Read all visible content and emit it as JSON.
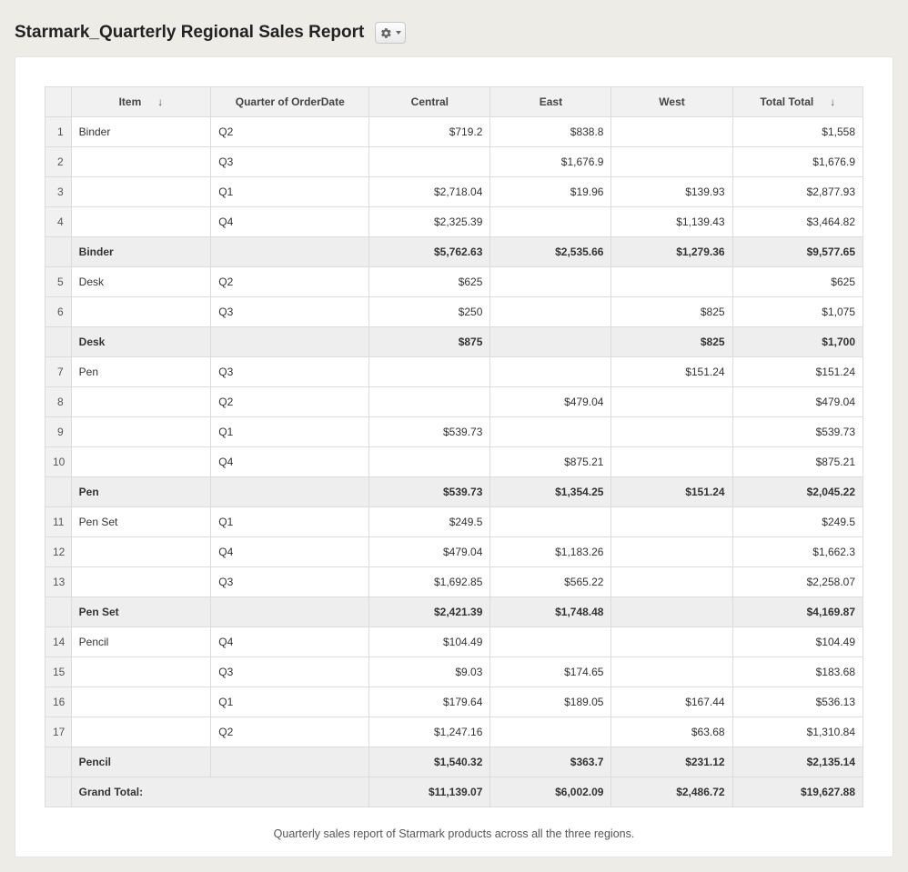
{
  "title": "Starmark_Quarterly Regional Sales Report",
  "columns": {
    "item": "Item",
    "quarter": "Quarter of OrderDate",
    "central": "Central",
    "east": "East",
    "west": "West",
    "total": "Total Total"
  },
  "sort_glyph": "↓",
  "groups": [
    {
      "name": "Binder",
      "rows": [
        {
          "n": "1",
          "quarter": "Q2",
          "central": "$719.2",
          "east": "$838.8",
          "west": "",
          "total": "$1,558"
        },
        {
          "n": "2",
          "quarter": "Q3",
          "central": "",
          "east": "$1,676.9",
          "west": "",
          "total": "$1,676.9"
        },
        {
          "n": "3",
          "quarter": "Q1",
          "central": "$2,718.04",
          "east": "$19.96",
          "west": "$139.93",
          "total": "$2,877.93"
        },
        {
          "n": "4",
          "quarter": "Q4",
          "central": "$2,325.39",
          "east": "",
          "west": "$1,139.43",
          "total": "$3,464.82"
        }
      ],
      "subtotal": {
        "central": "$5,762.63",
        "east": "$2,535.66",
        "west": "$1,279.36",
        "total": "$9,577.65"
      }
    },
    {
      "name": "Desk",
      "rows": [
        {
          "n": "5",
          "quarter": "Q2",
          "central": "$625",
          "east": "",
          "west": "",
          "total": "$625"
        },
        {
          "n": "6",
          "quarter": "Q3",
          "central": "$250",
          "east": "",
          "west": "$825",
          "total": "$1,075"
        }
      ],
      "subtotal": {
        "central": "$875",
        "east": "",
        "west": "$825",
        "total": "$1,700"
      }
    },
    {
      "name": "Pen",
      "rows": [
        {
          "n": "7",
          "quarter": "Q3",
          "central": "",
          "east": "",
          "west": "$151.24",
          "total": "$151.24"
        },
        {
          "n": "8",
          "quarter": "Q2",
          "central": "",
          "east": "$479.04",
          "west": "",
          "total": "$479.04"
        },
        {
          "n": "9",
          "quarter": "Q1",
          "central": "$539.73",
          "east": "",
          "west": "",
          "total": "$539.73"
        },
        {
          "n": "10",
          "quarter": "Q4",
          "central": "",
          "east": "$875.21",
          "west": "",
          "total": "$875.21"
        }
      ],
      "subtotal": {
        "central": "$539.73",
        "east": "$1,354.25",
        "west": "$151.24",
        "total": "$2,045.22"
      }
    },
    {
      "name": "Pen Set",
      "rows": [
        {
          "n": "11",
          "quarter": "Q1",
          "central": "$249.5",
          "east": "",
          "west": "",
          "total": "$249.5"
        },
        {
          "n": "12",
          "quarter": "Q4",
          "central": "$479.04",
          "east": "$1,183.26",
          "west": "",
          "total": "$1,662.3"
        },
        {
          "n": "13",
          "quarter": "Q3",
          "central": "$1,692.85",
          "east": "$565.22",
          "west": "",
          "total": "$2,258.07"
        }
      ],
      "subtotal": {
        "central": "$2,421.39",
        "east": "$1,748.48",
        "west": "",
        "total": "$4,169.87"
      }
    },
    {
      "name": "Pencil",
      "rows": [
        {
          "n": "14",
          "quarter": "Q4",
          "central": "$104.49",
          "east": "",
          "west": "",
          "total": "$104.49"
        },
        {
          "n": "15",
          "quarter": "Q3",
          "central": "$9.03",
          "east": "$174.65",
          "west": "",
          "total": "$183.68"
        },
        {
          "n": "16",
          "quarter": "Q1",
          "central": "$179.64",
          "east": "$189.05",
          "west": "$167.44",
          "total": "$536.13"
        },
        {
          "n": "17",
          "quarter": "Q2",
          "central": "$1,247.16",
          "east": "",
          "west": "$63.68",
          "total": "$1,310.84"
        }
      ],
      "subtotal": {
        "central": "$1,540.32",
        "east": "$363.7",
        "west": "$231.12",
        "total": "$2,135.14"
      }
    }
  ],
  "grand": {
    "label": "Grand Total:",
    "central": "$11,139.07",
    "east": "$6,002.09",
    "west": "$2,486.72",
    "total": "$19,627.88"
  },
  "caption": "Quarterly sales report of Starmark products across all the three regions."
}
